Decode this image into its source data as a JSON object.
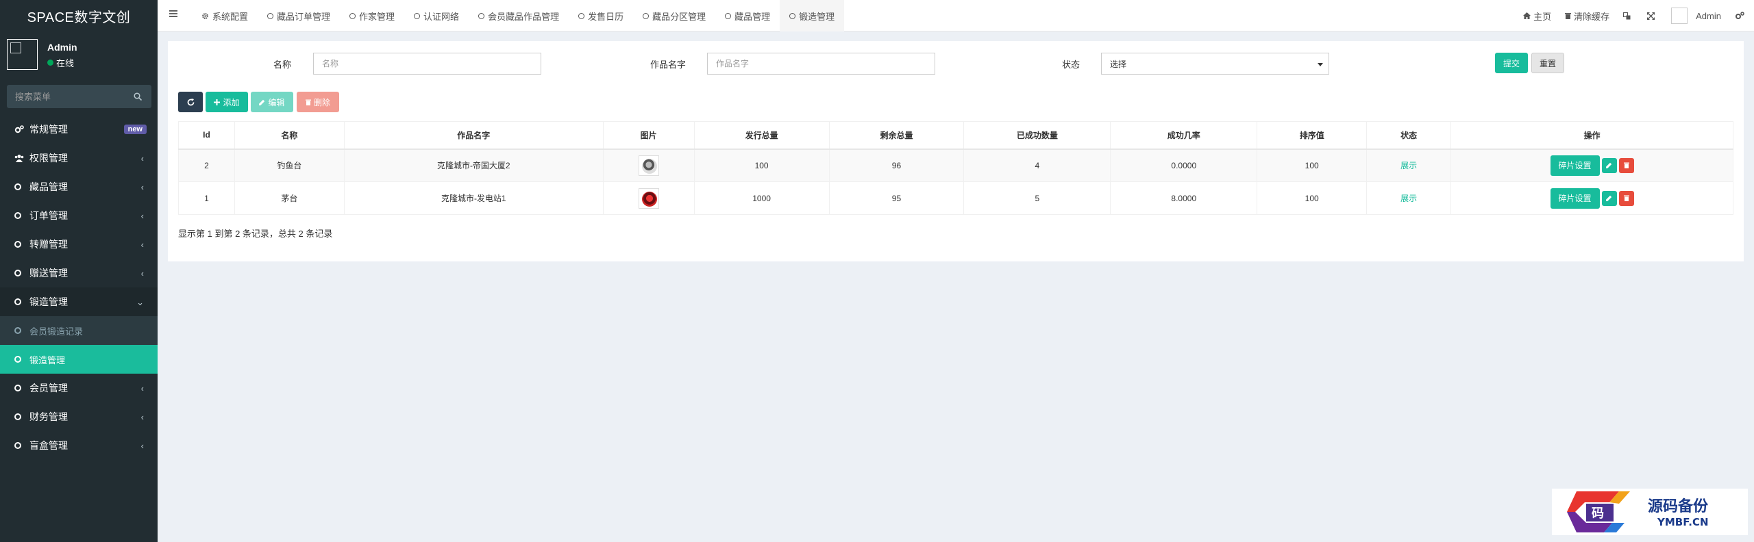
{
  "app": {
    "title": "SPACE数字文创"
  },
  "user": {
    "name": "Admin",
    "status": "在线"
  },
  "sidebar": {
    "search_placeholder": "搜索菜单",
    "items": [
      {
        "label": "常规管理",
        "icon": "gears-icon",
        "badge": "new"
      },
      {
        "label": "权限管理",
        "icon": "group-icon"
      },
      {
        "label": "藏品管理",
        "icon": "circle-icon"
      },
      {
        "label": "订单管理",
        "icon": "circle-icon"
      },
      {
        "label": "转赠管理",
        "icon": "circle-icon"
      },
      {
        "label": "赠送管理",
        "icon": "circle-icon"
      },
      {
        "label": "锻造管理",
        "icon": "circle-icon",
        "open": true
      },
      {
        "label": "会员锻造记录",
        "icon": "circle-icon",
        "sub": true
      },
      {
        "label": "锻造管理",
        "icon": "circle-icon",
        "sub": true,
        "active": true
      },
      {
        "label": "会员管理",
        "icon": "circle-icon"
      },
      {
        "label": "财务管理",
        "icon": "circle-icon"
      },
      {
        "label": "盲盒管理",
        "icon": "circle-icon"
      }
    ]
  },
  "topbar": {
    "tabs": [
      {
        "label": "系统配置",
        "icon": "gear-icon"
      },
      {
        "label": "藏品订单管理",
        "icon": "circle-icon"
      },
      {
        "label": "作家管理",
        "icon": "circle-icon"
      },
      {
        "label": "认证网络",
        "icon": "circle-icon"
      },
      {
        "label": "会员藏品作品管理",
        "icon": "circle-icon"
      },
      {
        "label": "发售日历",
        "icon": "circle-icon"
      },
      {
        "label": "藏品分区管理",
        "icon": "circle-icon"
      },
      {
        "label": "藏品管理",
        "icon": "circle-icon"
      },
      {
        "label": "锻造管理",
        "icon": "circle-icon",
        "active": true
      }
    ],
    "home_label": "主页",
    "clear_cache_label": "清除缓存",
    "user_label": "Admin"
  },
  "filter": {
    "name_label": "名称",
    "name_placeholder": "名称",
    "work_label": "作品名字",
    "work_placeholder": "作品名字",
    "status_label": "状态",
    "status_value": "选择",
    "submit_label": "提交",
    "reset_label": "重置"
  },
  "toolbar": {
    "add_label": "添加",
    "edit_label": "编辑",
    "delete_label": "删除"
  },
  "table": {
    "headers": [
      "Id",
      "名称",
      "作品名字",
      "图片",
      "发行总量",
      "剩余总量",
      "已成功数量",
      "成功几率",
      "排序值",
      "状态",
      "操作"
    ],
    "rows": [
      {
        "id": "2",
        "name": "钓鱼台",
        "work": "克隆城市-帝国大厦2",
        "total": "100",
        "remaining": "96",
        "success": "4",
        "rate": "0.0000",
        "sort": "100",
        "status": "展示",
        "frag_label": "碎片设置"
      },
      {
        "id": "1",
        "name": "茅台",
        "work": "克隆城市-发电站1",
        "total": "1000",
        "remaining": "95",
        "success": "5",
        "rate": "8.0000",
        "sort": "100",
        "status": "展示",
        "frag_label": "碎片设置"
      }
    ],
    "summary": "显示第 1 到第 2 条记录，总共 2 条记录"
  },
  "watermark": {
    "title": "源码备份",
    "subtitle": "YMBF.CN"
  },
  "colors": {
    "accent": "#18bc9c",
    "sidebar_bg": "#222d32",
    "danger": "#e74c3c"
  }
}
